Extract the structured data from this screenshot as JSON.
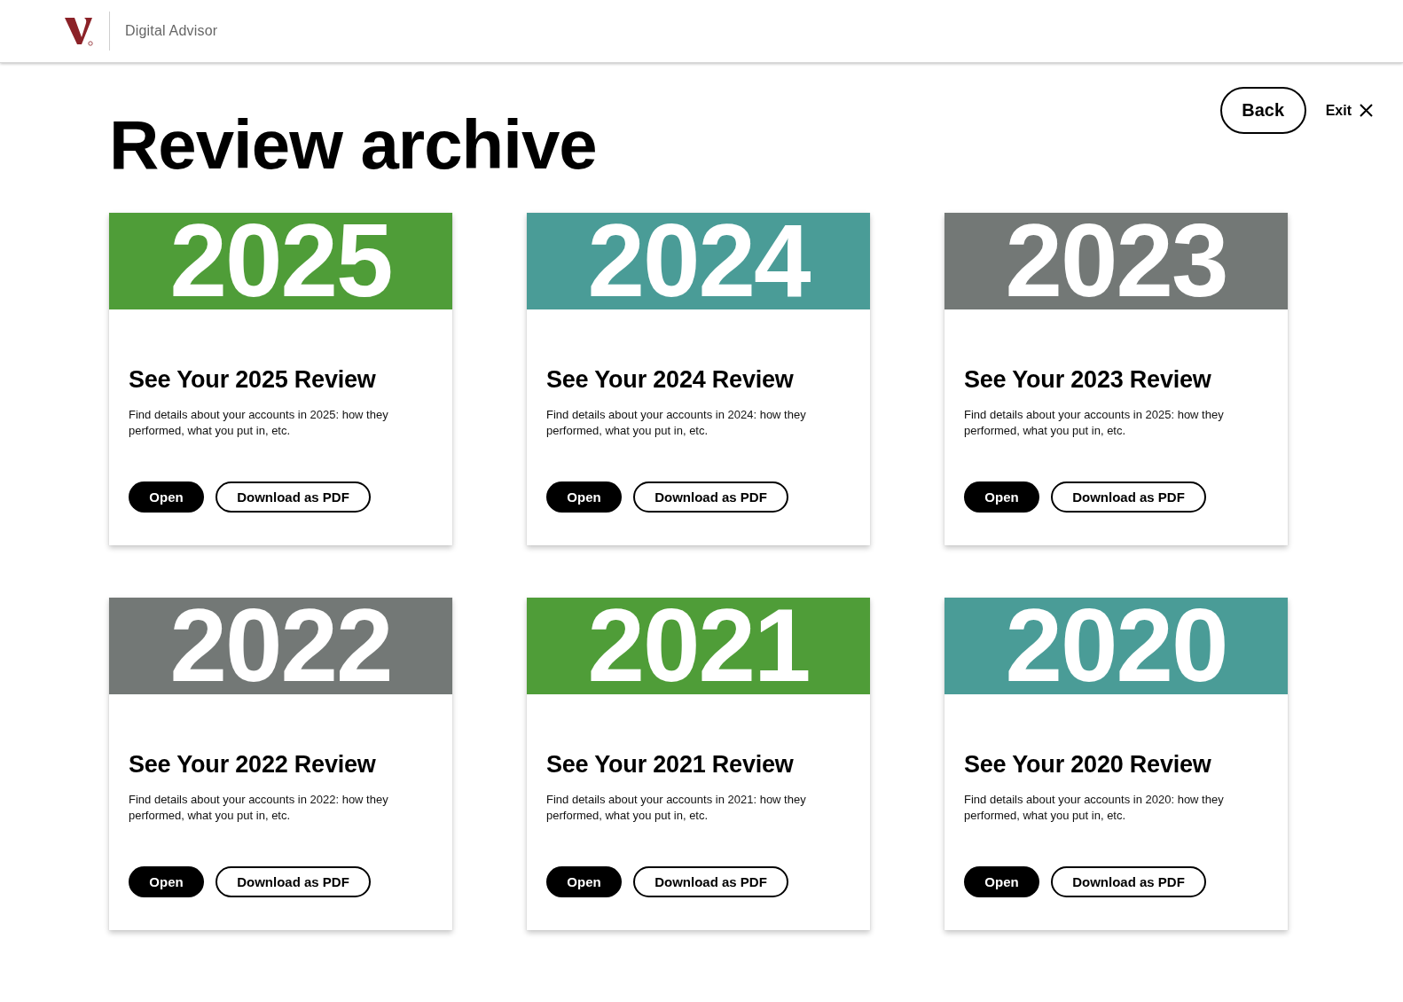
{
  "header": {
    "product": "Digital Advisor"
  },
  "page": {
    "title": "Review archive",
    "back": "Back",
    "exit": "Exit"
  },
  "cards": [
    {
      "year": "2025",
      "color": "#4f9d38",
      "title": "See Your 2025 Review",
      "description": "Find details about your accounts in 2025: how they performed, what you put in, etc.",
      "open": "Open",
      "download": "Download as PDF"
    },
    {
      "year": "2024",
      "color": "#4a9c97",
      "title": "See Your 2024 Review",
      "description": "Find details about your accounts in 2024: how they performed, what you put in, etc.",
      "open": "Open",
      "download": "Download as PDF"
    },
    {
      "year": "2023",
      "color": "#737876",
      "title": "See Your 2023 Review",
      "description": "Find details about your accounts in 2025: how they performed, what you put in, etc.",
      "open": "Open",
      "download": "Download as PDF"
    },
    {
      "year": "2022",
      "color": "#737876",
      "title": "See Your 2022 Review",
      "description": "Find details about your accounts in 2022: how they performed, what you put in, etc.",
      "open": "Open",
      "download": "Download as PDF"
    },
    {
      "year": "2021",
      "color": "#4f9d38",
      "title": "See Your 2021 Review",
      "description": "Find details about your accounts in 2021: how they performed, what you put in, etc.",
      "open": "Open",
      "download": "Download as PDF"
    },
    {
      "year": "2020",
      "color": "#4a9c97",
      "title": "See Your 2020 Review",
      "description": "Find details about your accounts in 2020: how they performed, what you put in, etc.",
      "open": "Open",
      "download": "Download as PDF"
    }
  ]
}
